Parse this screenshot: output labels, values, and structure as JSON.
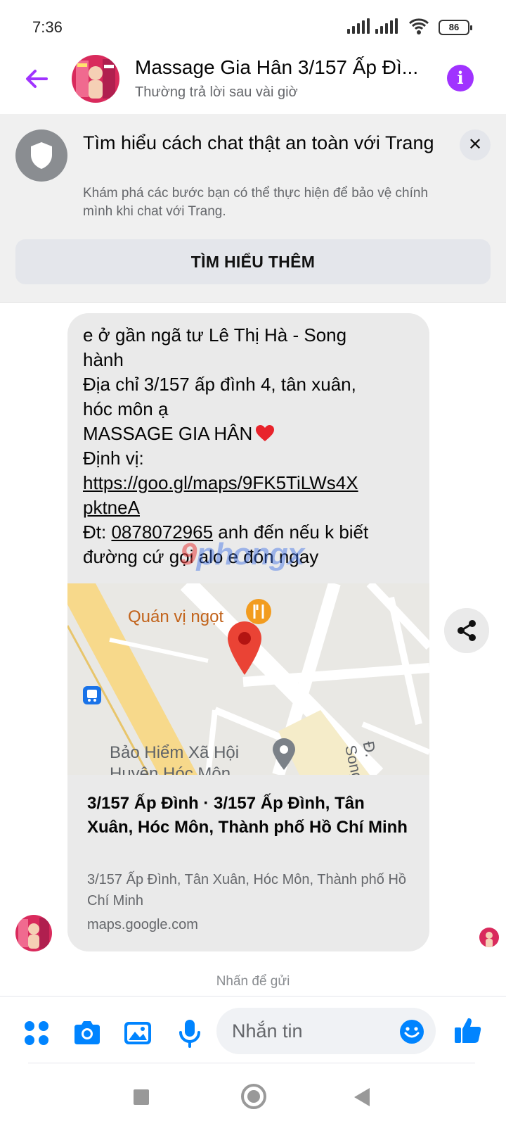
{
  "status_bar": {
    "time": "7:36",
    "battery": "86"
  },
  "header": {
    "title": "Massage Gia Hân 3/157 Ấp Đì...",
    "subtitle": "Thường trả lời sau vài giờ"
  },
  "safety_banner": {
    "title": "Tìm hiểu cách chat thật an toàn với Trang",
    "description": "Khám phá các bước bạn có thể thực hiện để bảo vệ chính mình khi chat với Trang.",
    "button_label": "TÌM HIỂU THÊM"
  },
  "message": {
    "lines": [
      "e ở gần ngã tư Lê Thị Hà - Song",
      "hành",
      "Địa chỉ 3/157 ấp đình 4, tân xuân,",
      "hóc môn ạ",
      "MASSAGE GIA HÂN",
      "Định vị:"
    ],
    "link_line1": "https://goo.gl/maps/9FK5TiLWs4X",
    "link_line2": "pktneA",
    "phone_prefix": "Đt: ",
    "phone": "0878072965",
    "phone_suffix": " anh đến nếu k biết",
    "last_line": "đường cứ gọi alo e đón ngay"
  },
  "watermark": {
    "part1": "9",
    "part2": "phongx"
  },
  "map": {
    "poi_food": "Quán vị ngọt",
    "poi_office_line1": "Bảo Hiểm Xã Hội",
    "poi_office_line2": "Huyện Hóc Môn",
    "road_label": "Đ. Song"
  },
  "link_card": {
    "title": "3/157 Ấp Đình · 3/157 Ấp Đình, Tân Xuân, Hóc Môn, Thành phố Hồ Chí Minh",
    "address": "3/157 Ấp Đình, Tân Xuân, Hóc Môn, Thành phố Hồ Chí Minh",
    "domain": "maps.google.com"
  },
  "tap_to_send": "Nhấn để gửi",
  "composer": {
    "placeholder": "Nhắn tin"
  },
  "colors": {
    "accent": "#a033ff",
    "messenger_blue": "#0084ff",
    "bubble": "#eaeaea",
    "banner_bg": "#f0f0f0",
    "secondary_text": "#65676b"
  },
  "icons": {
    "back": "arrow-left-icon",
    "info": "info-icon",
    "shield": "shield-icon",
    "close": "close-icon",
    "share": "share-icon",
    "menu": "apps-grid-icon",
    "camera": "camera-icon",
    "gallery": "image-icon",
    "mic": "microphone-icon",
    "emoji": "emoji-icon",
    "like": "thumbs-up-icon"
  }
}
